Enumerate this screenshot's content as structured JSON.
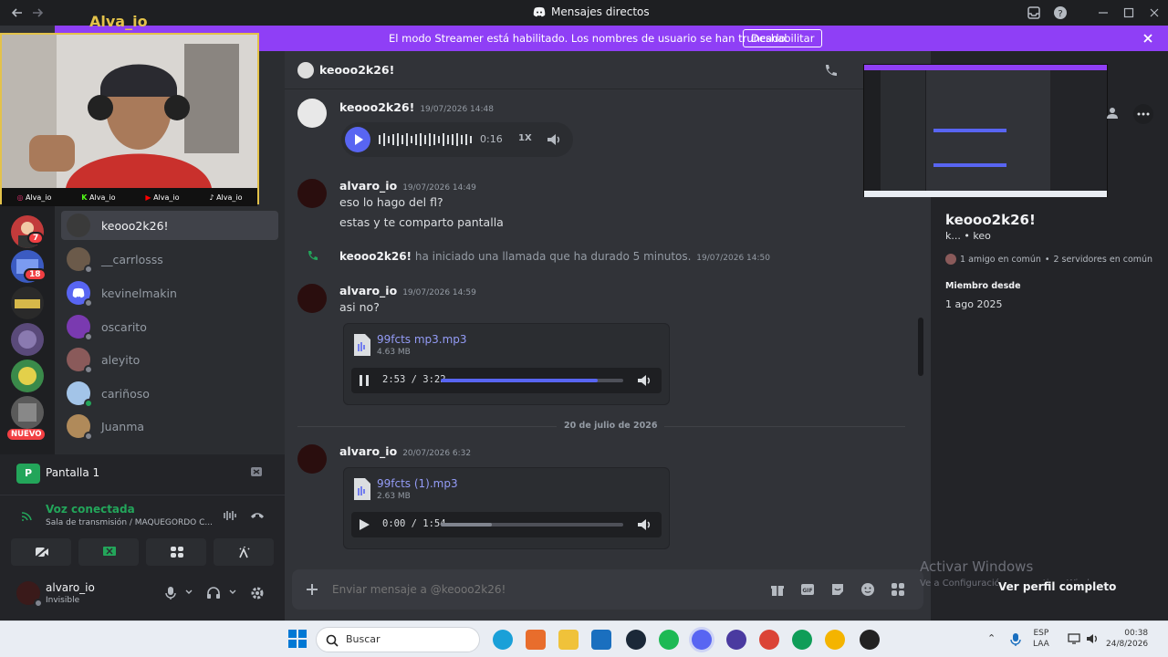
{
  "titlebar": {
    "title": "Mensajes directos"
  },
  "banner": {
    "text": "El modo Streamer está habilitado. Los nombres de usuario se han truncado.",
    "button": "Deshabilitar"
  },
  "overlay": {
    "channel_name": "Alva_io",
    "socials": [
      "Alva_io",
      "Alva_io",
      "Alva_io",
      "Alva_io"
    ]
  },
  "rail": {
    "badge1": "7",
    "badge2": "18",
    "new_label": "NUEVO"
  },
  "dms": [
    {
      "name": "keooo2k26!",
      "active": true
    },
    {
      "name": "__carrlosss"
    },
    {
      "name": "kevinelmakin"
    },
    {
      "name": "oscarito"
    },
    {
      "name": "aleyito"
    },
    {
      "name": "cariñoso"
    },
    {
      "name": "Juanma"
    }
  ],
  "screenshare": {
    "title": "Pantalla 1"
  },
  "voice": {
    "status": "Voz conectada",
    "channel": "Sala de transmisión / MAQUEGORDO C..."
  },
  "user": {
    "name": "alvaro_io",
    "status": "Invisible"
  },
  "chat": {
    "header_name": "keooo2k26!",
    "messages": [
      {
        "author": "keooo2k26!",
        "time": "19/07/2026 14:48",
        "voice_duration": "0:16",
        "speed": "1X"
      },
      {
        "author": "alvaro_io",
        "time": "19/07/2026 14:49",
        "lines": [
          "eso lo hago del fl?",
          "estas y te comparto pantalla"
        ]
      },
      {
        "author": "keooo2k26!",
        "system": "ha iniciado una llamada que ha durado 5 minutos.",
        "time": "19/07/2026 14:50"
      },
      {
        "author": "alvaro_io",
        "time": "19/07/2026 14:59",
        "lines": [
          "asi no?"
        ],
        "file": {
          "name": "99fcts mp3.mp3",
          "size": "4.63 MB",
          "time": "2:53 / 3:22",
          "progress": 0.86
        }
      },
      {
        "divider": "20 de julio de 2026"
      },
      {
        "author": "alvaro_io",
        "time": "20/07/2026 6:32",
        "file": {
          "name": "99fcts (1).mp3",
          "size": "2.63 MB",
          "time": "0:00 / 1:54",
          "progress": 0.28
        }
      }
    ],
    "placeholder": "Enviar mensaje a @keooo2k26!"
  },
  "profile": {
    "display_name": "keooo2k26!",
    "username": "k...",
    "pronoun": "keo",
    "mutual_friends": "1 amigo en común",
    "mutual_servers": "2 servidores en común",
    "member_since_label": "Miembro desde",
    "member_since": "1 ago 2025",
    "full_profile": "Ver perfil completo"
  },
  "watermark": {
    "line1": "Activar Windows",
    "line2": "Ve a Configuración para activar Windows."
  },
  "taskbar": {
    "search": "Buscar",
    "lang1": "ESP",
    "lang2": "LAA",
    "time": "00:38",
    "date": "24/8/2026"
  },
  "colors": {
    "blurple": "#5865f2",
    "streamer_banner": "#8f3ff6",
    "online": "#23a55a",
    "mention_red": "#f23f43"
  }
}
